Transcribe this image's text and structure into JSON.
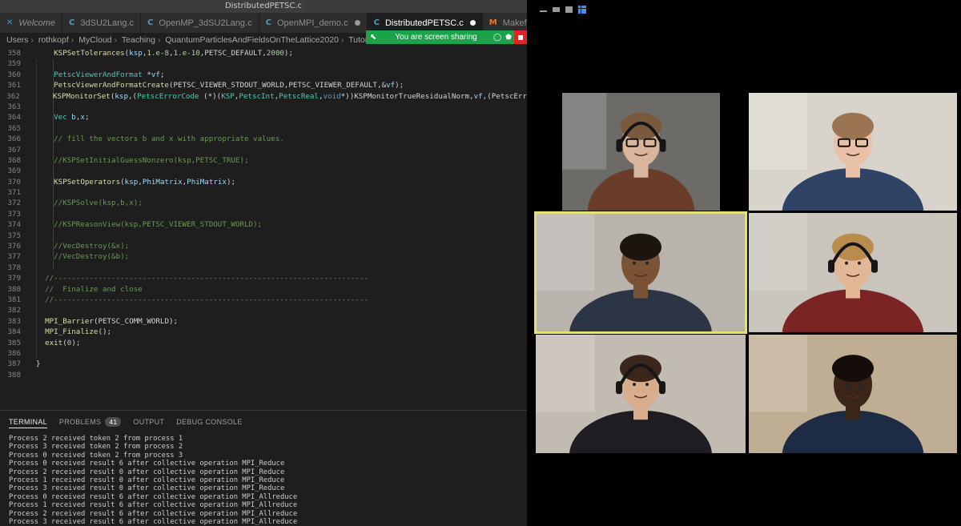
{
  "window_title": "DistributedPETSC.c",
  "tabs": [
    {
      "label": "Welcome",
      "icon": "vscode-icon",
      "active": false,
      "modified": false
    },
    {
      "label": "3dSU2Lang.c",
      "icon": "c-file-icon",
      "active": false,
      "modified": false
    },
    {
      "label": "OpenMP_3dSU2Lang.c",
      "icon": "c-file-icon",
      "active": false,
      "modified": false
    },
    {
      "label": "OpenMPI_demo.c",
      "icon": "c-file-icon",
      "active": false,
      "modified": true
    },
    {
      "label": "DistributedPETSC.c",
      "icon": "c-file-icon",
      "active": true,
      "modified": true
    },
    {
      "label": "Makefile",
      "icon": "makefile-icon",
      "active": false,
      "modified": false
    }
  ],
  "breadcrumb": [
    "Users",
    "rothkopf",
    "MyCloud",
    "Teaching",
    "QuantumParticlesAndFieldsOnTheLattice2020",
    "Tutorials"
  ],
  "share_banner": {
    "text": "You are screen sharing"
  },
  "code_lines": [
    {
      "n": "358",
      "t": "    KSPSetTolerances(ksp,1.e-8,1.e-10,PETSC_DEFAULT,2000);"
    },
    {
      "n": "359",
      "t": ""
    },
    {
      "n": "360",
      "t": "    PetscViewerAndFormat *vf;"
    },
    {
      "n": "361",
      "t": "    PetscViewerAndFormatCreate(PETSC_VIEWER_STDOUT_WORLD,PETSC_VIEWER_DEFAULT,&vf);"
    },
    {
      "n": "362",
      "t": "    KSPMonitorSet(ksp,(PetscErrorCode (*)(KSP,PetscInt,PetscReal,void*))KSPMonitorTrueResidualNorm,vf,(PetscErr"
    },
    {
      "n": "363",
      "t": ""
    },
    {
      "n": "364",
      "t": "    Vec b,x;"
    },
    {
      "n": "365",
      "t": ""
    },
    {
      "n": "366",
      "t": "    // fill the vectors b and x with appropriate values."
    },
    {
      "n": "367",
      "t": ""
    },
    {
      "n": "368",
      "t": "    //KSPSetInitialGuessNonzero(ksp,PETSC_TRUE);"
    },
    {
      "n": "369",
      "t": ""
    },
    {
      "n": "370",
      "t": "    KSPSetOperators(ksp,PhiMatrix,PhiMatrix);"
    },
    {
      "n": "371",
      "t": ""
    },
    {
      "n": "372",
      "t": "    //KSPSolve(ksp,b,x);"
    },
    {
      "n": "373",
      "t": ""
    },
    {
      "n": "374",
      "t": "    //KSPReasonView(ksp,PETSC_VIEWER_STDOUT_WORLD);"
    },
    {
      "n": "375",
      "t": ""
    },
    {
      "n": "376",
      "t": "    //VecDestroy(&x);"
    },
    {
      "n": "377",
      "t": "    //VecDestroy(&b);"
    },
    {
      "n": "378",
      "t": ""
    },
    {
      "n": "379",
      "t": "  //-----------------------------------------------------------------------"
    },
    {
      "n": "380",
      "t": "  //  Finalize and close"
    },
    {
      "n": "381",
      "t": "  //-----------------------------------------------------------------------"
    },
    {
      "n": "382",
      "t": ""
    },
    {
      "n": "383",
      "t": "  MPI_Barrier(PETSC_COMM_WORLD);"
    },
    {
      "n": "384",
      "t": "  MPI_Finalize();"
    },
    {
      "n": "385",
      "t": "  exit(0);"
    },
    {
      "n": "386",
      "t": ""
    },
    {
      "n": "387",
      "t": "}"
    },
    {
      "n": "388",
      "t": ""
    }
  ],
  "panel": {
    "tabs": [
      "TERMINAL",
      "PROBLEMS",
      "OUTPUT",
      "DEBUG CONSOLE"
    ],
    "problems_count": "41",
    "active_tab": "TERMINAL"
  },
  "terminal_lines": [
    "Process 2 received token 2 from process 1",
    "Process 3 received token 2 from process 2",
    "Process 0 received token 2 from process 3",
    "Process 0 received result 6 after collective operation MPI_Reduce",
    "Process 2 received result 0 after collective operation MPI_Reduce",
    "Process 1 received result 0 after collective operation MPI_Reduce",
    "Process 3 received result 0 after collective operation MPI_Reduce",
    "Process 0 received result 6 after collective operation MPI_Allreduce",
    "Process 1 received result 6 after collective operation MPI_Allreduce",
    "Process 2 received result 6 after collective operation MPI_Allreduce",
    "Process 3 received result 6 after collective operation MPI_Allreduce"
  ],
  "call": {
    "participants": [
      {
        "id": "p1",
        "active_speaker": false,
        "bg": "#6d6b68",
        "skin": "#d9b59b",
        "hair": "#7a5a3c",
        "shirt": "#6a3d2b",
        "glasses": true,
        "headphones": true
      },
      {
        "id": "p2",
        "active_speaker": false,
        "bg": "#d8d4cc",
        "skin": "#e8c1a6",
        "hair": "#9b7552",
        "shirt": "#2e4365",
        "glasses": true,
        "headphones": false
      },
      {
        "id": "p3",
        "active_speaker": true,
        "bg": "#b9b3ad",
        "skin": "#7a5236",
        "hair": "#1b140f",
        "shirt": "#2c3546",
        "glasses": false,
        "headphones": false
      },
      {
        "id": "p4",
        "active_speaker": false,
        "bg": "#c9c5bd",
        "skin": "#e2b796",
        "hair": "#b98c4e",
        "shirt": "#7a2424",
        "glasses": false,
        "headphones": true
      },
      {
        "id": "p5",
        "active_speaker": false,
        "bg": "#c2bbb2",
        "skin": "#d7ad8d",
        "hair": "#3a261a",
        "shirt": "#1e1e22",
        "glasses": false,
        "headphones": true
      },
      {
        "id": "p6",
        "active_speaker": false,
        "bg": "#bfae93",
        "skin": "#3b2418",
        "hair": "#140d09",
        "shirt": "#1d2b45",
        "glasses": false,
        "headphones": false
      }
    ]
  }
}
